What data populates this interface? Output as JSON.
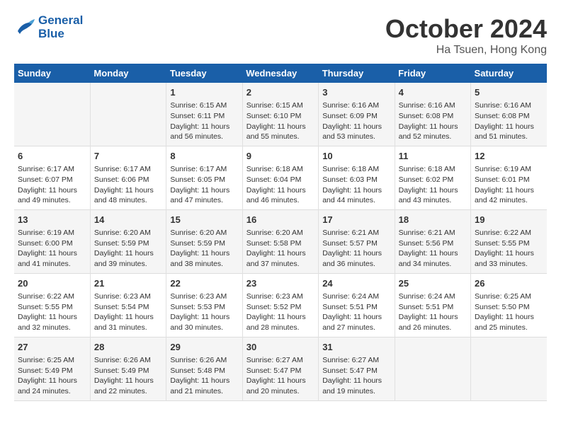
{
  "header": {
    "logo_line1": "General",
    "logo_line2": "Blue",
    "month": "October 2024",
    "location": "Ha Tsuen, Hong Kong"
  },
  "days_of_week": [
    "Sunday",
    "Monday",
    "Tuesday",
    "Wednesday",
    "Thursday",
    "Friday",
    "Saturday"
  ],
  "weeks": [
    [
      {
        "day": "",
        "info": ""
      },
      {
        "day": "",
        "info": ""
      },
      {
        "day": "1",
        "info": "Sunrise: 6:15 AM\nSunset: 6:11 PM\nDaylight: 11 hours and 56 minutes."
      },
      {
        "day": "2",
        "info": "Sunrise: 6:15 AM\nSunset: 6:10 PM\nDaylight: 11 hours and 55 minutes."
      },
      {
        "day": "3",
        "info": "Sunrise: 6:16 AM\nSunset: 6:09 PM\nDaylight: 11 hours and 53 minutes."
      },
      {
        "day": "4",
        "info": "Sunrise: 6:16 AM\nSunset: 6:08 PM\nDaylight: 11 hours and 52 minutes."
      },
      {
        "day": "5",
        "info": "Sunrise: 6:16 AM\nSunset: 6:08 PM\nDaylight: 11 hours and 51 minutes."
      }
    ],
    [
      {
        "day": "6",
        "info": "Sunrise: 6:17 AM\nSunset: 6:07 PM\nDaylight: 11 hours and 49 minutes."
      },
      {
        "day": "7",
        "info": "Sunrise: 6:17 AM\nSunset: 6:06 PM\nDaylight: 11 hours and 48 minutes."
      },
      {
        "day": "8",
        "info": "Sunrise: 6:17 AM\nSunset: 6:05 PM\nDaylight: 11 hours and 47 minutes."
      },
      {
        "day": "9",
        "info": "Sunrise: 6:18 AM\nSunset: 6:04 PM\nDaylight: 11 hours and 46 minutes."
      },
      {
        "day": "10",
        "info": "Sunrise: 6:18 AM\nSunset: 6:03 PM\nDaylight: 11 hours and 44 minutes."
      },
      {
        "day": "11",
        "info": "Sunrise: 6:18 AM\nSunset: 6:02 PM\nDaylight: 11 hours and 43 minutes."
      },
      {
        "day": "12",
        "info": "Sunrise: 6:19 AM\nSunset: 6:01 PM\nDaylight: 11 hours and 42 minutes."
      }
    ],
    [
      {
        "day": "13",
        "info": "Sunrise: 6:19 AM\nSunset: 6:00 PM\nDaylight: 11 hours and 41 minutes."
      },
      {
        "day": "14",
        "info": "Sunrise: 6:20 AM\nSunset: 5:59 PM\nDaylight: 11 hours and 39 minutes."
      },
      {
        "day": "15",
        "info": "Sunrise: 6:20 AM\nSunset: 5:59 PM\nDaylight: 11 hours and 38 minutes."
      },
      {
        "day": "16",
        "info": "Sunrise: 6:20 AM\nSunset: 5:58 PM\nDaylight: 11 hours and 37 minutes."
      },
      {
        "day": "17",
        "info": "Sunrise: 6:21 AM\nSunset: 5:57 PM\nDaylight: 11 hours and 36 minutes."
      },
      {
        "day": "18",
        "info": "Sunrise: 6:21 AM\nSunset: 5:56 PM\nDaylight: 11 hours and 34 minutes."
      },
      {
        "day": "19",
        "info": "Sunrise: 6:22 AM\nSunset: 5:55 PM\nDaylight: 11 hours and 33 minutes."
      }
    ],
    [
      {
        "day": "20",
        "info": "Sunrise: 6:22 AM\nSunset: 5:55 PM\nDaylight: 11 hours and 32 minutes."
      },
      {
        "day": "21",
        "info": "Sunrise: 6:23 AM\nSunset: 5:54 PM\nDaylight: 11 hours and 31 minutes."
      },
      {
        "day": "22",
        "info": "Sunrise: 6:23 AM\nSunset: 5:53 PM\nDaylight: 11 hours and 30 minutes."
      },
      {
        "day": "23",
        "info": "Sunrise: 6:23 AM\nSunset: 5:52 PM\nDaylight: 11 hours and 28 minutes."
      },
      {
        "day": "24",
        "info": "Sunrise: 6:24 AM\nSunset: 5:51 PM\nDaylight: 11 hours and 27 minutes."
      },
      {
        "day": "25",
        "info": "Sunrise: 6:24 AM\nSunset: 5:51 PM\nDaylight: 11 hours and 26 minutes."
      },
      {
        "day": "26",
        "info": "Sunrise: 6:25 AM\nSunset: 5:50 PM\nDaylight: 11 hours and 25 minutes."
      }
    ],
    [
      {
        "day": "27",
        "info": "Sunrise: 6:25 AM\nSunset: 5:49 PM\nDaylight: 11 hours and 24 minutes."
      },
      {
        "day": "28",
        "info": "Sunrise: 6:26 AM\nSunset: 5:49 PM\nDaylight: 11 hours and 22 minutes."
      },
      {
        "day": "29",
        "info": "Sunrise: 6:26 AM\nSunset: 5:48 PM\nDaylight: 11 hours and 21 minutes."
      },
      {
        "day": "30",
        "info": "Sunrise: 6:27 AM\nSunset: 5:47 PM\nDaylight: 11 hours and 20 minutes."
      },
      {
        "day": "31",
        "info": "Sunrise: 6:27 AM\nSunset: 5:47 PM\nDaylight: 11 hours and 19 minutes."
      },
      {
        "day": "",
        "info": ""
      },
      {
        "day": "",
        "info": ""
      }
    ]
  ]
}
